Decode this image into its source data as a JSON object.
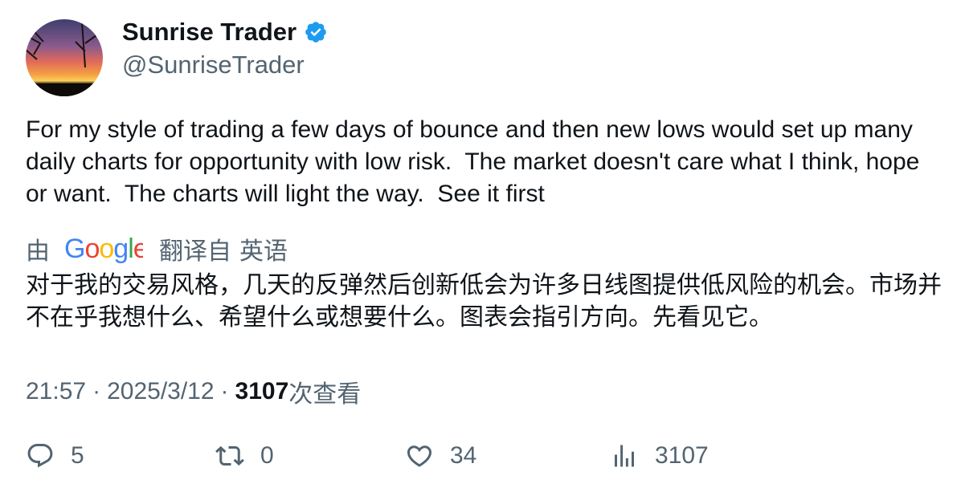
{
  "author": {
    "display_name": "Sunrise Trader",
    "handle": "@SunriseTrader",
    "verified": true,
    "avatar_icon": "sunset-landscape-avatar",
    "verified_color": "#1d9bf0"
  },
  "tweet": {
    "text": "For my style of trading a few days of bounce and then new lows would set up many daily charts for opportunity with low risk.  The market doesn't care what I think, hope or want.  The charts will light the way.  See it first"
  },
  "translation": {
    "by": "由",
    "provider": "Google",
    "from_label": "翻译自",
    "language": "英语",
    "text": "对于我的交易风格，几天的反弹然后创新低会为许多日线图提供低风险的机会。市场并不在乎我想什么、希望什么或想要什么。图表会指引方向。先看见它。"
  },
  "meta": {
    "time": "21:57",
    "separator": "·",
    "date": "2025/3/12",
    "views_count": "3107",
    "views_label": "次查看"
  },
  "actions": {
    "reply": {
      "icon": "reply-icon",
      "count": "5"
    },
    "retweet": {
      "icon": "retweet-icon",
      "count": "0"
    },
    "like": {
      "icon": "heart-icon",
      "count": "34"
    },
    "views": {
      "icon": "analytics-icon",
      "count": "3107"
    }
  },
  "colors": {
    "text": "#0f1419",
    "secondary": "#536471",
    "google_blue": "#4285F4",
    "google_red": "#EA4335",
    "google_yellow": "#FBBC05",
    "google_green": "#34A853"
  }
}
